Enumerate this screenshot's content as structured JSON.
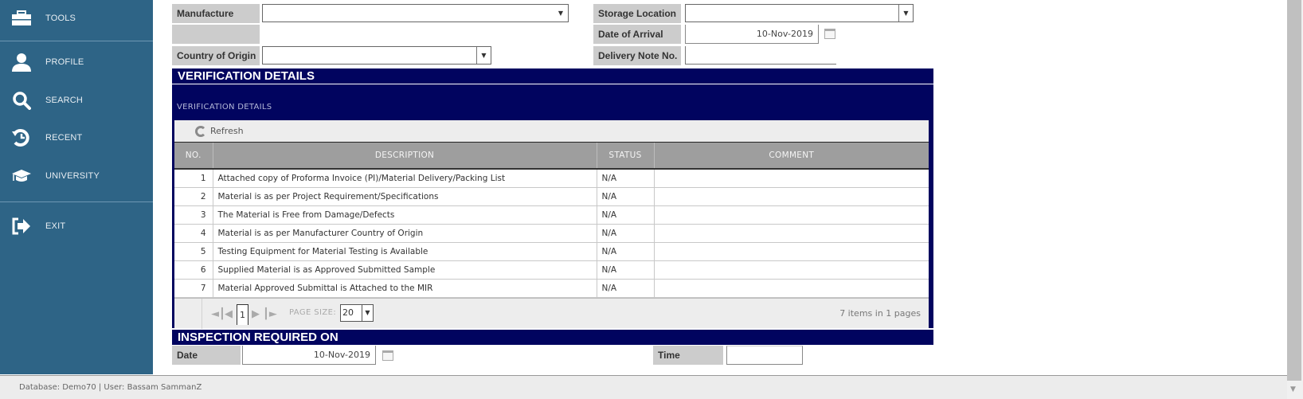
{
  "sidebar": {
    "items": [
      {
        "label": "TOOLS",
        "icon": "toolbox-icon"
      },
      {
        "label": "PROFILE",
        "icon": "user-icon"
      },
      {
        "label": "SEARCH",
        "icon": "search-icon"
      },
      {
        "label": "RECENT",
        "icon": "history-icon"
      },
      {
        "label": "UNIVERSITY",
        "icon": "graduation-cap-icon"
      },
      {
        "label": "EXIT",
        "icon": "exit-icon"
      }
    ]
  },
  "form": {
    "manufacture_label": "Manufacture",
    "manufacture_value": "",
    "country_label": "Country of Origin",
    "country_value": "",
    "storage_label": "Storage Location",
    "storage_value": "",
    "arrival_label": "Date of Arrival",
    "arrival_value": "10-Nov-2019",
    "delivery_label": "Delivery Note No.",
    "delivery_value": ""
  },
  "verification": {
    "section_title": "VERIFICATION DETAILS",
    "panel_subtitle": "VERIFICATION DETAILS",
    "refresh_label": "Refresh",
    "columns": [
      "NO.",
      "DESCRIPTION",
      "STATUS",
      "COMMENT"
    ],
    "rows": [
      {
        "no": "1",
        "description": "Attached copy of Proforma Invoice (PI)/Material Delivery/Packing List",
        "status": "N/A",
        "comment": ""
      },
      {
        "no": "2",
        "description": "Material is as per Project Requirement/Specifications",
        "status": "N/A",
        "comment": ""
      },
      {
        "no": "3",
        "description": "The Material is Free from Damage/Defects",
        "status": "N/A",
        "comment": ""
      },
      {
        "no": "4",
        "description": "Material is as per Manufacturer Country of Origin",
        "status": "N/A",
        "comment": ""
      },
      {
        "no": "5",
        "description": "Testing Equipment for Material Testing is Available",
        "status": "N/A",
        "comment": ""
      },
      {
        "no": "6",
        "description": "Supplied Material is as Approved Submitted Sample",
        "status": "N/A",
        "comment": ""
      },
      {
        "no": "7",
        "description": "Material Approved Submittal is Attached to the MIR",
        "status": "N/A",
        "comment": ""
      }
    ],
    "pager": {
      "current_page": "1",
      "page_size_label": "PAGE SIZE:",
      "page_size": "20",
      "info": "7 items in 1 pages"
    }
  },
  "inspection": {
    "section_title": "INSPECTION REQUIRED ON",
    "date_label": "Date",
    "date_value": "10-Nov-2019",
    "time_label": "Time",
    "time_value": ""
  },
  "status_bar": {
    "text": "Database: Demo70 | User: Bassam SammanZ"
  },
  "colors": {
    "sidebar_bg": "#2e6486",
    "section_bg": "#01045f",
    "label_bg": "#cccccc",
    "grid_header_bg": "#9e9e9e"
  }
}
